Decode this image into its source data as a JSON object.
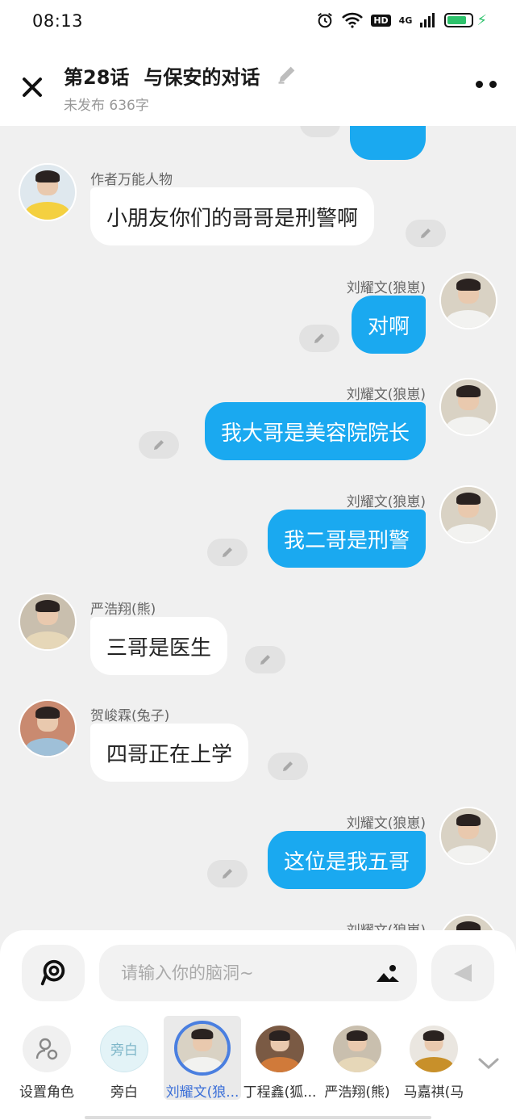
{
  "status_bar": {
    "time": "08:13",
    "hd": "HD",
    "net": "4G"
  },
  "header": {
    "episode": "第28话",
    "title": "与保安的对话",
    "subtitle": "未发布 636字"
  },
  "messages": [
    {
      "side": "left",
      "name": "作者万能人物",
      "text": "小朋友你们的哥哥是刑警啊"
    },
    {
      "side": "right",
      "name": "刘耀文(狼崽)",
      "text": "对啊"
    },
    {
      "side": "right",
      "name": "刘耀文(狼崽)",
      "text": "我大哥是美容院院长"
    },
    {
      "side": "right",
      "name": "刘耀文(狼崽)",
      "text": "我二哥是刑警"
    },
    {
      "side": "left",
      "name": "严浩翔(熊)",
      "text": "三哥是医生"
    },
    {
      "side": "left",
      "name": "贺峻霖(兔子)",
      "text": "四哥正在上学"
    },
    {
      "side": "right",
      "name": "刘耀文(狼崽)",
      "text": "这位是我五哥"
    },
    {
      "side": "right",
      "name": "刘耀文(狼崽)",
      "text": ""
    }
  ],
  "composer": {
    "placeholder": "请输入你的脑洞~"
  },
  "roles": [
    {
      "label": "设置角色"
    },
    {
      "label": "旁白",
      "badge": "旁白"
    },
    {
      "label": "刘耀文(狼..."
    },
    {
      "label": "丁程鑫(狐..."
    },
    {
      "label": "严浩翔(熊)"
    },
    {
      "label": "马嘉祺(马"
    }
  ],
  "colors": {
    "accent": "#1aa9f0",
    "active_role": "#3b6fd8",
    "battery": "#2dc26b"
  }
}
